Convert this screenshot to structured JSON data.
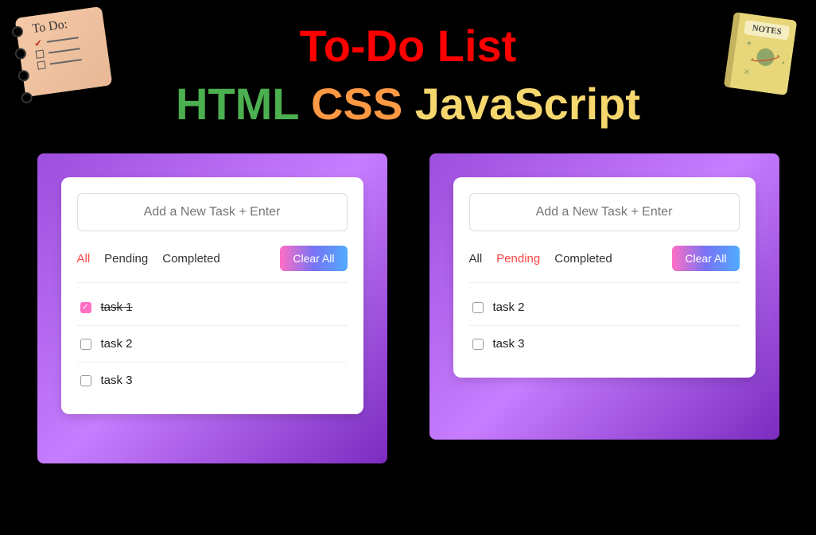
{
  "header": {
    "title": "To-Do List",
    "tech1": "HTML",
    "tech2": "CSS",
    "tech3": "JavaScript"
  },
  "todoIcon": {
    "label": "To Do:"
  },
  "notesIcon": {
    "label": "NOTES"
  },
  "panel1": {
    "input_placeholder": "Add a New Task + Enter",
    "filters": {
      "all": "All",
      "pending": "Pending",
      "completed": "Completed"
    },
    "active_filter": "All",
    "clear_label": "Clear All",
    "tasks": [
      {
        "text": "task 1",
        "done": true
      },
      {
        "text": "task 2",
        "done": false
      },
      {
        "text": "task 3",
        "done": false
      }
    ]
  },
  "panel2": {
    "input_placeholder": "Add a New Task + Enter",
    "filters": {
      "all": "All",
      "pending": "Pending",
      "completed": "Completed"
    },
    "active_filter": "Pending",
    "clear_label": "Clear All",
    "tasks": [
      {
        "text": "task 2",
        "done": false
      },
      {
        "text": "task 3",
        "done": false
      }
    ]
  }
}
